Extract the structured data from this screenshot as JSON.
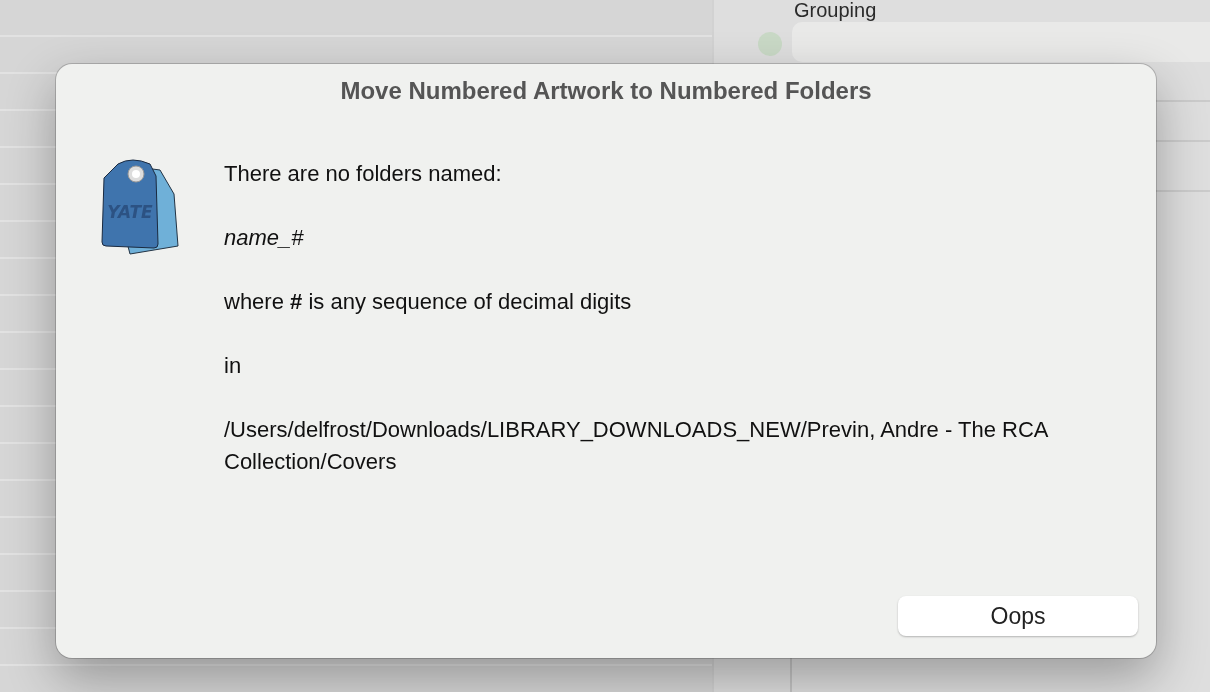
{
  "background": {
    "grouping_label": "Grouping"
  },
  "dialog": {
    "title": "Move Numbered Artwork to Numbered Folders",
    "app_icon": {
      "label": "YATE"
    },
    "message": [
      "There are no folders named:",
      "*name_#*",
      "where **#** is any sequence of decimal digits",
      "in",
      "/Users/delfrost/Downloads/LIBRARY_DOWNLOADS_NEW/Previn, Andre - The RCA Collection/Covers"
    ],
    "buttons": [
      "Oops"
    ]
  }
}
